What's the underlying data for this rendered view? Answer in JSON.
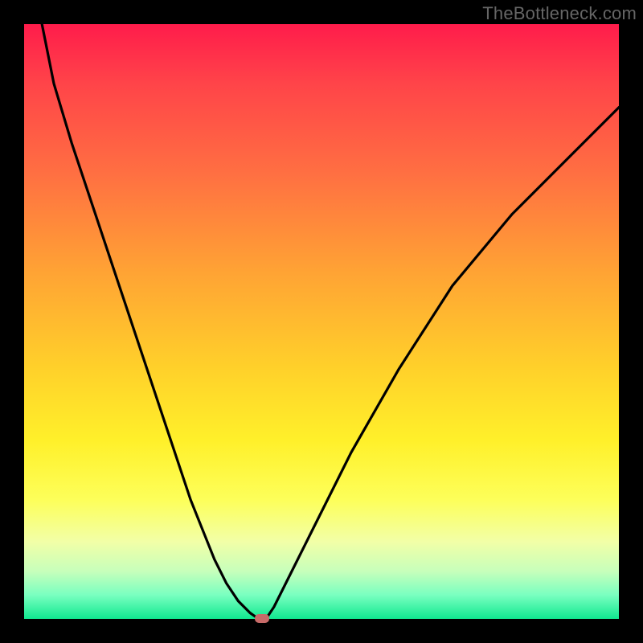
{
  "watermark": {
    "text": "TheBottleneck.com"
  },
  "chart_data": {
    "type": "line",
    "title": "",
    "xlabel": "",
    "ylabel": "",
    "xlim": [
      0,
      100
    ],
    "ylim": [
      0,
      100
    ],
    "grid": false,
    "series": [
      {
        "name": "bottleneck-curve",
        "x": [
          3,
          5,
          8,
          12,
          16,
          20,
          24,
          28,
          32,
          34,
          36,
          38,
          39,
          40,
          41,
          42,
          44,
          48,
          55,
          63,
          72,
          82,
          92,
          100
        ],
        "y": [
          100,
          90,
          80,
          68,
          56,
          44,
          32,
          20,
          10,
          6,
          3,
          1,
          0.3,
          0,
          0.5,
          2,
          6,
          14,
          28,
          42,
          56,
          68,
          78,
          86
        ]
      }
    ],
    "annotations": [
      {
        "name": "optimal-marker",
        "x": 40,
        "y": 0
      }
    ],
    "background_gradient": {
      "top": "#ff1c4b",
      "mid1": "#ffa434",
      "mid2": "#fff02a",
      "bottom": "#10e890"
    }
  },
  "marker": {
    "color": "#c86b69"
  }
}
